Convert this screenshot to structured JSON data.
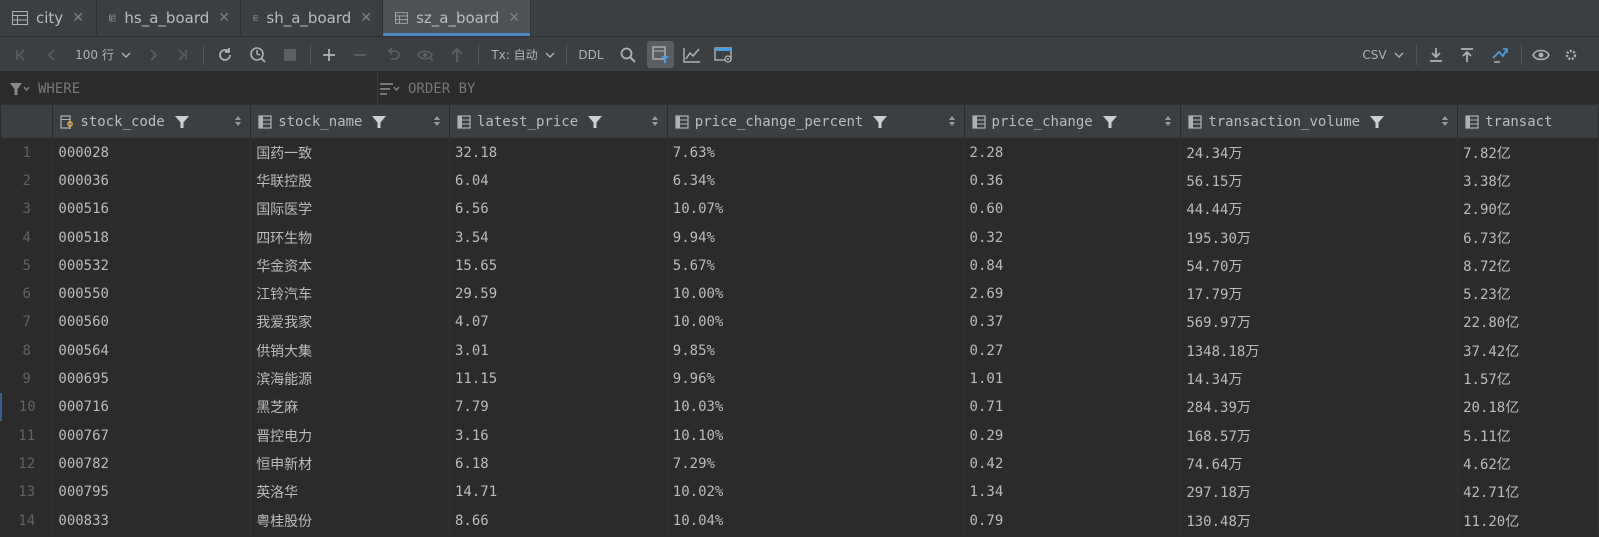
{
  "tabs": [
    {
      "label": "city",
      "active": false
    },
    {
      "label": "hs_a_board",
      "active": false
    },
    {
      "label": "sh_a_board",
      "active": false
    },
    {
      "label": "sz_a_board",
      "active": true
    }
  ],
  "toolbar": {
    "page_size": "100 行",
    "tx_mode": "Tx: 自动",
    "ddl_label": "DDL",
    "export_format": "CSV"
  },
  "filter": {
    "where_placeholder": "WHERE",
    "orderby_placeholder": "ORDER BY"
  },
  "grid": {
    "columns": [
      "stock_code",
      "stock_name",
      "latest_price",
      "price_change_percent",
      "price_change",
      "transaction_volume",
      "transact"
    ],
    "rows": [
      {
        "n": "1",
        "cells": [
          "000028",
          "国药一致",
          "32.18",
          "7.63%",
          "2.28",
          "24.34万",
          "7.82亿"
        ]
      },
      {
        "n": "2",
        "cells": [
          "000036",
          "华联控股",
          "6.04",
          "6.34%",
          "0.36",
          "56.15万",
          "3.38亿"
        ]
      },
      {
        "n": "3",
        "cells": [
          "000516",
          "国际医学",
          "6.56",
          "10.07%",
          "0.60",
          "44.44万",
          "2.90亿"
        ]
      },
      {
        "n": "4",
        "cells": [
          "000518",
          "四环生物",
          "3.54",
          "9.94%",
          "0.32",
          "195.30万",
          "6.73亿"
        ]
      },
      {
        "n": "5",
        "cells": [
          "000532",
          "华金资本",
          "15.65",
          "5.67%",
          "0.84",
          "54.70万",
          "8.72亿"
        ]
      },
      {
        "n": "6",
        "cells": [
          "000550",
          "江铃汽车",
          "29.59",
          "10.00%",
          "2.69",
          "17.79万",
          "5.23亿"
        ]
      },
      {
        "n": "7",
        "cells": [
          "000560",
          "我爱我家",
          "4.07",
          "10.00%",
          "0.37",
          "569.97万",
          "22.80亿"
        ]
      },
      {
        "n": "8",
        "cells": [
          "000564",
          "供销大集",
          "3.01",
          "9.85%",
          "0.27",
          "1348.18万",
          "37.42亿"
        ]
      },
      {
        "n": "9",
        "cells": [
          "000695",
          "滨海能源",
          "11.15",
          "9.96%",
          "1.01",
          "14.34万",
          "1.57亿"
        ]
      },
      {
        "n": "10",
        "cells": [
          "000716",
          "黑芝麻",
          "7.79",
          "10.03%",
          "0.71",
          "284.39万",
          "20.18亿"
        ]
      },
      {
        "n": "11",
        "cells": [
          "000767",
          "晋控电力",
          "3.16",
          "10.10%",
          "0.29",
          "168.57万",
          "5.11亿"
        ]
      },
      {
        "n": "12",
        "cells": [
          "000782",
          "恒申新材",
          "6.18",
          "7.29%",
          "0.42",
          "74.64万",
          "4.62亿"
        ]
      },
      {
        "n": "13",
        "cells": [
          "000795",
          "英洛华",
          "14.71",
          "10.02%",
          "1.34",
          "297.18万",
          "42.71亿"
        ]
      },
      {
        "n": "14",
        "cells": [
          "000833",
          "粤桂股份",
          "8.66",
          "10.04%",
          "0.79",
          "130.48万",
          "11.20亿"
        ]
      }
    ]
  }
}
